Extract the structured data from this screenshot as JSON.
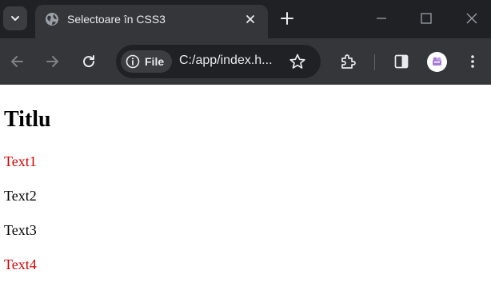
{
  "browser": {
    "tab": {
      "title": "Selectoare în CSS3"
    },
    "site_chip": {
      "label": "File"
    },
    "address_bar": {
      "url": "C:/app/index.h..."
    }
  },
  "page": {
    "heading": "Titlu",
    "paragraphs": [
      {
        "text": "Text1",
        "color": "#cc0000"
      },
      {
        "text": "Text2",
        "color": "#000000"
      },
      {
        "text": "Text3",
        "color": "#000000"
      },
      {
        "text": "Text4",
        "color": "#cc0000"
      }
    ]
  },
  "icons": [
    "chevron-down-icon",
    "globe-icon",
    "close-icon",
    "plus-icon",
    "minimize-icon",
    "maximize-icon",
    "window-close-icon",
    "back-icon",
    "forward-icon",
    "reload-icon",
    "info-icon",
    "star-icon",
    "extensions-icon",
    "side-panel-icon",
    "profile-avatar",
    "more-menu-icon"
  ],
  "colors": {
    "tabbar_bg": "#202124",
    "toolbar_bg": "#35363a",
    "accent_red": "#cc0000"
  }
}
